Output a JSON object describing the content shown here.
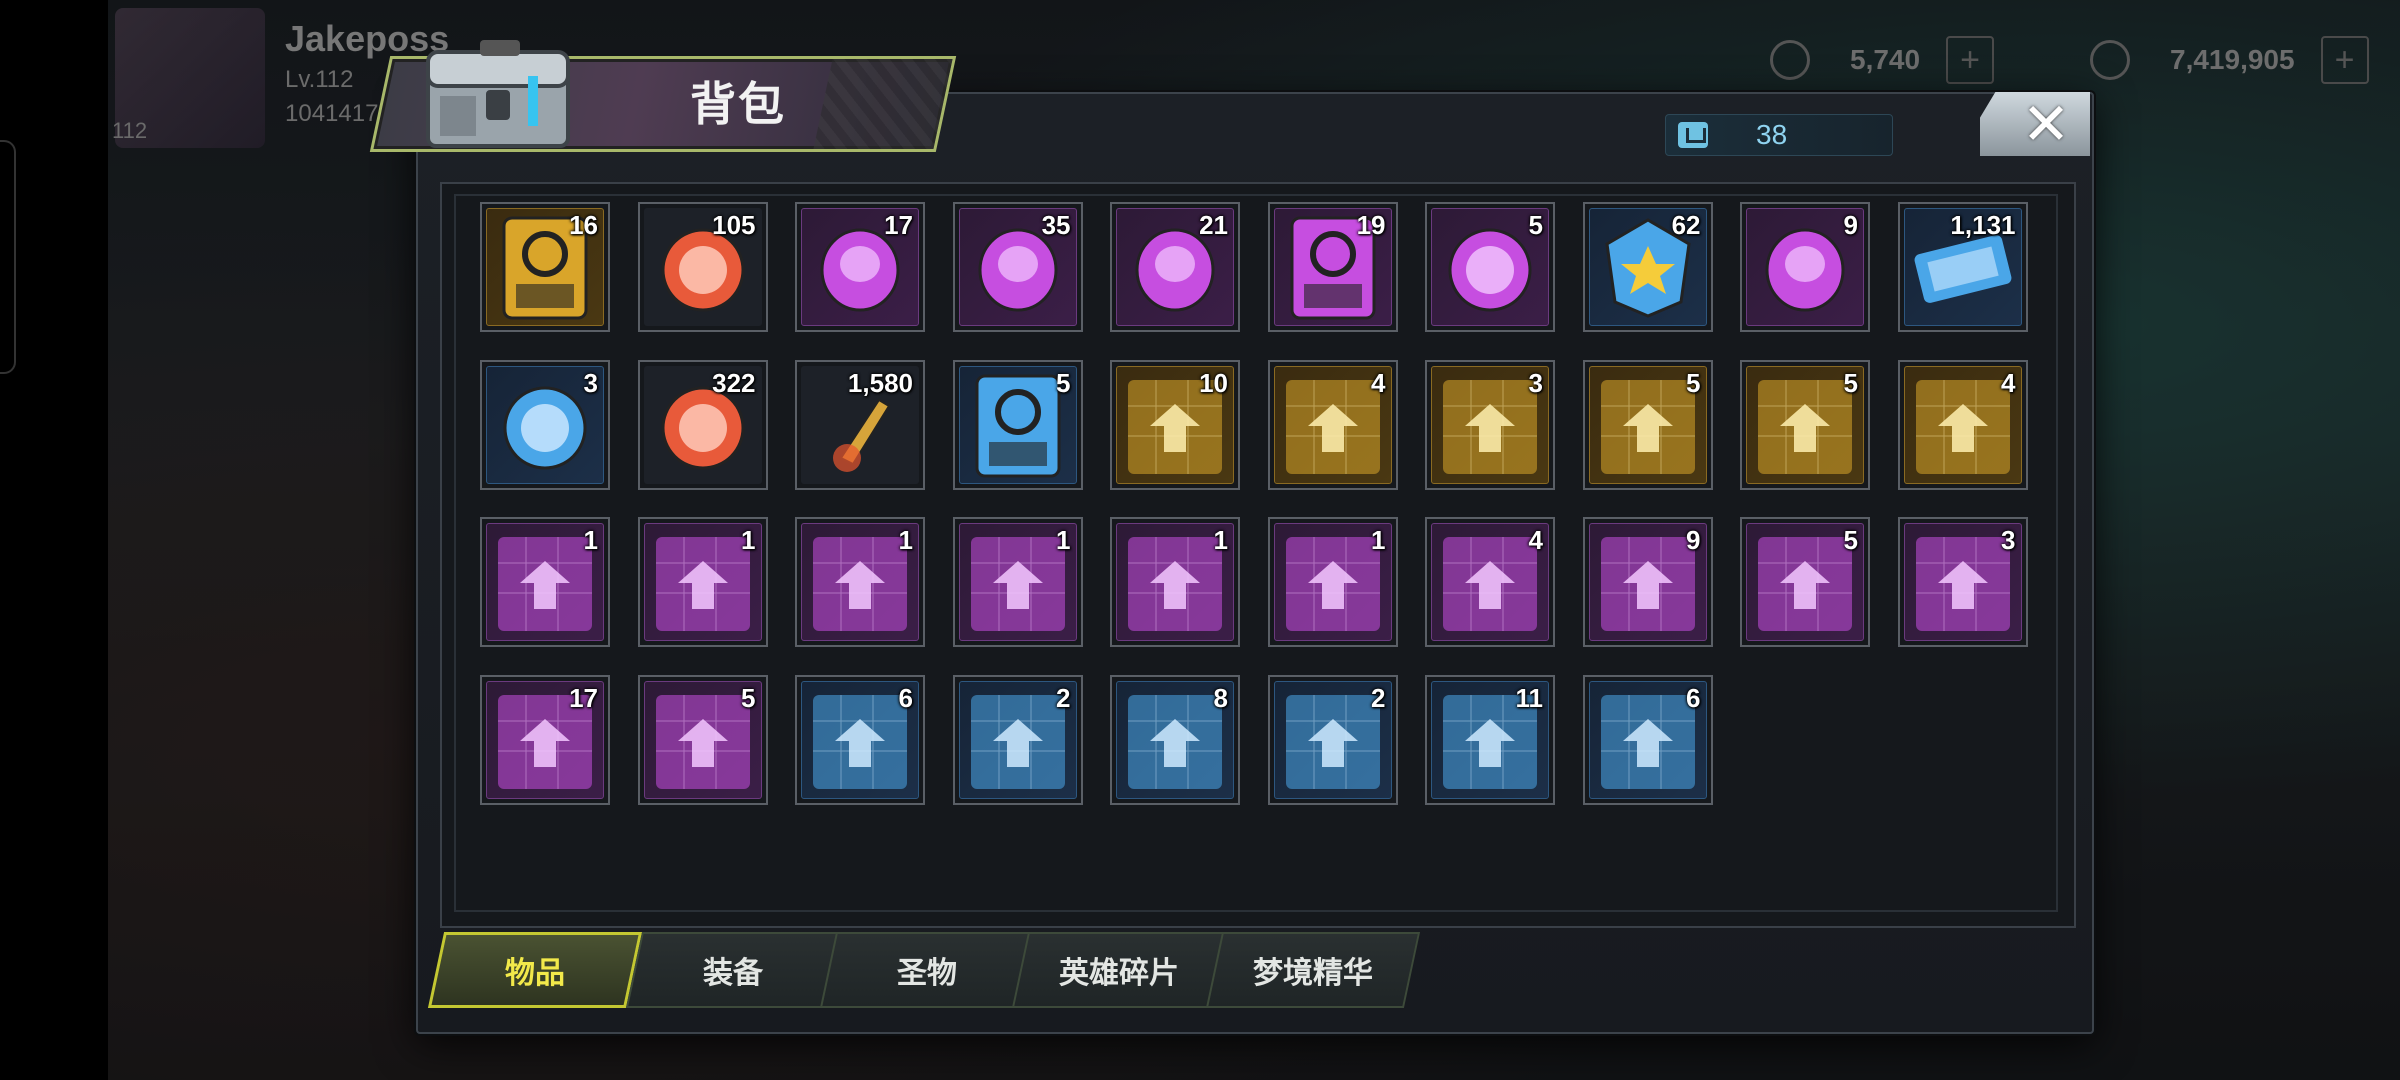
{
  "hud": {
    "player_name": "Jakeposs",
    "player_level": "Lv.112",
    "player_power": "1041417",
    "player_badge": "112",
    "currencies": [
      {
        "icon": "gem-icon",
        "value": "5,740"
      },
      {
        "icon": "gold-coin-icon",
        "value": "7,419,905"
      }
    ]
  },
  "dialog": {
    "title": "背包",
    "capacity": "38",
    "close_label": "✕"
  },
  "items": [
    {
      "icon": "24h-speedup-card-icon",
      "qty": "16",
      "rarity": "gold"
    },
    {
      "icon": "red-bottle-cap-icon",
      "qty": "105",
      "rarity": "dark"
    },
    {
      "icon": "robot-toy-icon",
      "qty": "17",
      "rarity": "purple"
    },
    {
      "icon": "film-reel-icon",
      "qty": "35",
      "rarity": "purple"
    },
    {
      "icon": "swirl-capsule-icon",
      "qty": "21",
      "rarity": "purple"
    },
    {
      "icon": "12h-speedup-card-icon",
      "qty": "19",
      "rarity": "purple"
    },
    {
      "icon": "purple-bottle-cap-icon",
      "qty": "5",
      "rarity": "purple"
    },
    {
      "icon": "police-badge-icon",
      "qty": "62",
      "rarity": "blue"
    },
    {
      "icon": "purple-syringe-icon",
      "qty": "9",
      "rarity": "purple"
    },
    {
      "icon": "cinema-ticket-icon",
      "qty": "1,131",
      "rarity": "blue"
    },
    {
      "icon": "blue-bottle-cap-icon",
      "qty": "3",
      "rarity": "blue"
    },
    {
      "icon": "poker-chip-icon",
      "qty": "322",
      "rarity": "dark"
    },
    {
      "icon": "bullet-icon",
      "qty": "1,580",
      "rarity": "dark"
    },
    {
      "icon": "4h-speedup-card-icon",
      "qty": "5",
      "rarity": "blue"
    },
    {
      "icon": "gold-glasses-blueprint-icon",
      "qty": "10",
      "rarity": "gold"
    },
    {
      "icon": "gold-hat-blueprint-icon",
      "qty": "4",
      "rarity": "gold"
    },
    {
      "icon": "gold-shirt-blueprint-icon",
      "qty": "3",
      "rarity": "gold"
    },
    {
      "icon": "gold-revolver-blueprint-icon",
      "qty": "5",
      "rarity": "gold"
    },
    {
      "icon": "gold-boot-blueprint-icon",
      "qty": "5",
      "rarity": "gold"
    },
    {
      "icon": "gold-sword-blueprint-icon",
      "qty": "4",
      "rarity": "gold"
    },
    {
      "icon": "purple-hat-blueprint-icon",
      "qty": "1",
      "rarity": "purple"
    },
    {
      "icon": "purple-shirt-blueprint-icon",
      "qty": "1",
      "rarity": "purple"
    },
    {
      "icon": "purple-revolver-blueprint-icon",
      "qty": "1",
      "rarity": "purple"
    },
    {
      "icon": "purple-boot-blueprint-icon",
      "qty": "1",
      "rarity": "purple"
    },
    {
      "icon": "purple-sword-blueprint-icon",
      "qty": "1",
      "rarity": "purple"
    },
    {
      "icon": "purple-glasses-blueprint-icon",
      "qty": "1",
      "rarity": "purple"
    },
    {
      "icon": "purple-sword-blueprint-icon",
      "qty": "4",
      "rarity": "purple"
    },
    {
      "icon": "purple-boot-blueprint-icon",
      "qty": "9",
      "rarity": "purple"
    },
    {
      "icon": "purple-glasses-blueprint-icon",
      "qty": "5",
      "rarity": "purple"
    },
    {
      "icon": "purple-revolver-blueprint-icon",
      "qty": "3",
      "rarity": "purple"
    },
    {
      "icon": "purple-shirt-blueprint-icon",
      "qty": "17",
      "rarity": "purple"
    },
    {
      "icon": "purple-hat-blueprint-icon",
      "qty": "5",
      "rarity": "purple"
    },
    {
      "icon": "blue-hat-blueprint-icon",
      "qty": "6",
      "rarity": "blue"
    },
    {
      "icon": "blue-shirt-blueprint-icon",
      "qty": "2",
      "rarity": "blue"
    },
    {
      "icon": "blue-revolver-blueprint-icon",
      "qty": "8",
      "rarity": "blue"
    },
    {
      "icon": "blue-sword-blueprint-icon",
      "qty": "2",
      "rarity": "blue"
    },
    {
      "icon": "blue-glasses-blueprint-icon",
      "qty": "11",
      "rarity": "blue"
    },
    {
      "icon": "blue-boot-blueprint-icon",
      "qty": "6",
      "rarity": "blue"
    }
  ],
  "tabs": [
    {
      "label": "物品",
      "active": true
    },
    {
      "label": "装备",
      "active": false
    },
    {
      "label": "圣物",
      "active": false
    },
    {
      "label": "英雄碎片",
      "active": false
    },
    {
      "label": "梦境精华",
      "active": false
    }
  ],
  "colors": {
    "active_tab_border": "#c4c832",
    "active_tab_text": "#f2e94a",
    "capacity_text": "#8fd3f0"
  }
}
